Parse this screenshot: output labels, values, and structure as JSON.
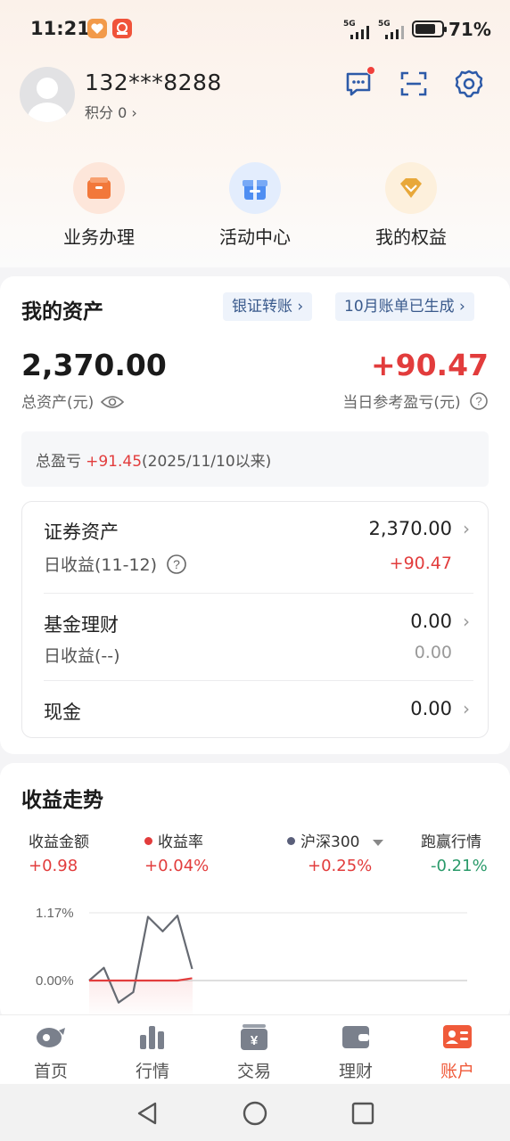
{
  "status_bar": {
    "time": "11:21",
    "signal1": "5G",
    "signal2": "5G",
    "battery_pct": "71%",
    "battery_level": 0.71
  },
  "profile": {
    "phone": "132***8288",
    "points_label": "积分 0",
    "icons": [
      "message-icon",
      "scan-icon",
      "settings-icon"
    ]
  },
  "shortcuts": [
    {
      "label": "业务办理",
      "icon": "briefcase-icon",
      "color": "#f2783a"
    },
    {
      "label": "活动中心",
      "icon": "gift-icon",
      "color": "#4f8ef2"
    },
    {
      "label": "我的权益",
      "icon": "diamond-icon",
      "color": "#e8b04a"
    }
  ],
  "assets": {
    "title": "我的资产",
    "bank_transfer": "银证转账",
    "bill_notice": "10月账单已生成",
    "total": "2,370.00",
    "total_label": "总资产(元)",
    "daily_pl": "+90.47",
    "daily_pl_label": "当日参考盈亏(元)",
    "total_pl_label": "总盈亏",
    "total_pl_value": "+91.45",
    "total_pl_since": "(2025/11/10以来)",
    "rows": [
      {
        "title": "证券资产",
        "value": "2,370.00",
        "sub": "日收益(11-12)",
        "subval": "+90.47"
      },
      {
        "title": "基金理财",
        "value": "0.00",
        "sub": "日收益(--)",
        "subval": "0.00"
      },
      {
        "title": "现金",
        "value": "0.00"
      }
    ]
  },
  "trend": {
    "title": "收益走势",
    "legend": [
      {
        "name": "收益金额",
        "value": "+0.98"
      },
      {
        "name": "收益率",
        "value": "+0.04%",
        "color": "#e23c3c"
      },
      {
        "name": "沪深300",
        "value": "+0.25%",
        "color": "#5a5f7a"
      },
      {
        "name": "跑赢行情",
        "value": "-0.21%"
      }
    ]
  },
  "chart_data": {
    "type": "line",
    "ytick_labels": [
      "1.17%",
      "0.00%"
    ],
    "ylim": [
      -0.4,
      1.17
    ],
    "x": [
      1,
      2,
      3,
      4,
      5,
      6,
      7
    ],
    "series": [
      {
        "name": "沪深300",
        "color": "#666a72",
        "values": [
          0.0,
          0.22,
          -0.38,
          -0.2,
          1.1,
          0.85,
          1.12,
          0.2
        ]
      },
      {
        "name": "收益率",
        "color": "#e23c3c",
        "values": [
          0.0,
          0.0,
          0.0,
          0.0,
          0.0,
          0.0,
          0.0,
          0.04
        ]
      }
    ]
  },
  "tabs": [
    {
      "label": "首页",
      "icon": "home-icon"
    },
    {
      "label": "行情",
      "icon": "market-icon"
    },
    {
      "label": "交易",
      "icon": "trade-icon"
    },
    {
      "label": "理财",
      "icon": "wallet-icon"
    },
    {
      "label": "账户",
      "icon": "account-icon",
      "active": true
    }
  ],
  "nav": [
    "back-icon",
    "home-circle-icon",
    "recents-icon"
  ]
}
